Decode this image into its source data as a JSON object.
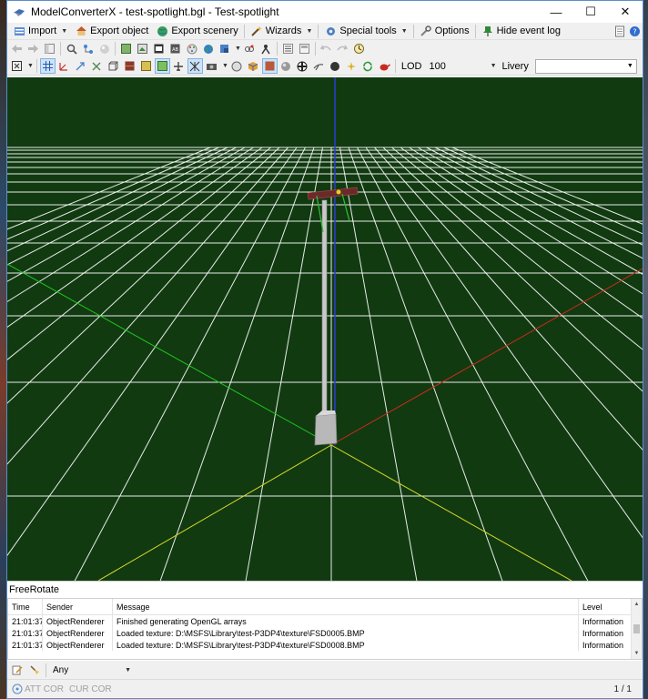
{
  "window": {
    "title": "ModelConverterX - test-spotlight.bgl - Test-spotlight",
    "minimize": "—",
    "maximize": "☐",
    "close": "✕"
  },
  "menu": {
    "import": "Import",
    "export_object": "Export object",
    "export_scenery": "Export scenery",
    "wizards": "Wizards",
    "special_tools": "Special tools",
    "options": "Options",
    "hide_event_log": "Hide event log"
  },
  "toolbar": {
    "lod_label": "LOD",
    "lod_value": "100",
    "livery_label": "Livery",
    "livery_value": ""
  },
  "viewport": {
    "mode": "FreeRotate",
    "background": "#113a11",
    "grid_color": "#ffffff",
    "axis_x_color": "#cc2a1a",
    "axis_y_color": "#2a3cd0",
    "axis_z_color": "#1ec81e",
    "ground_axis_color": "#dada2a"
  },
  "log": {
    "columns": [
      "Time",
      "Sender",
      "Message",
      "Level"
    ],
    "rows": [
      {
        "time": "21:01:37",
        "sender": "ObjectRenderer",
        "message": "Finished generating OpenGL arrays",
        "level": "Information"
      },
      {
        "time": "21:01:37",
        "sender": "ObjectRenderer",
        "message": "Loaded texture: D:\\MSFS\\Library\\test-P3DP4\\texture\\FSD0005.BMP",
        "level": "Information"
      },
      {
        "time": "21:01:37",
        "sender": "ObjectRenderer",
        "message": "Loaded texture: D:\\MSFS\\Library\\test-P3DP4\\texture\\FSD0008.BMP",
        "level": "Information"
      }
    ]
  },
  "filter": {
    "value": "Any"
  },
  "status": {
    "att_cor": "ATT COR",
    "cur_cor": "CUR COR",
    "pager": "1 / 1"
  }
}
